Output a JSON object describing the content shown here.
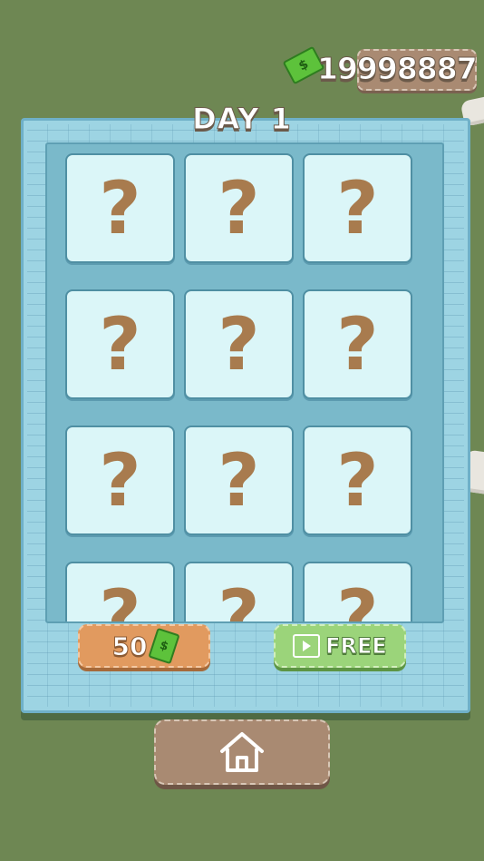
{
  "currency": {
    "amount": "19998887",
    "icon": "cash-icon",
    "bill_symbol": "$"
  },
  "title": "DAY 1",
  "cards": [
    {
      "symbol": "?"
    },
    {
      "symbol": "?"
    },
    {
      "symbol": "?"
    },
    {
      "symbol": "?"
    },
    {
      "symbol": "?"
    },
    {
      "symbol": "?"
    },
    {
      "symbol": "?"
    },
    {
      "symbol": "?"
    },
    {
      "symbol": "?"
    },
    {
      "symbol": "?"
    },
    {
      "symbol": "?"
    },
    {
      "symbol": "?"
    }
  ],
  "buttons": {
    "buy": {
      "label": "50",
      "icon": "cash-icon"
    },
    "free": {
      "label": "FREE",
      "icon": "video-icon"
    },
    "home": {
      "icon": "home-icon"
    }
  },
  "colors": {
    "background": "#6e8753",
    "board": "#9dd4e3",
    "card": "#dbf6f8",
    "question_mark": "#a87b4e",
    "buy_button": "#e19a5f",
    "free_button": "#9bd47a",
    "home_button": "#a98a72"
  }
}
